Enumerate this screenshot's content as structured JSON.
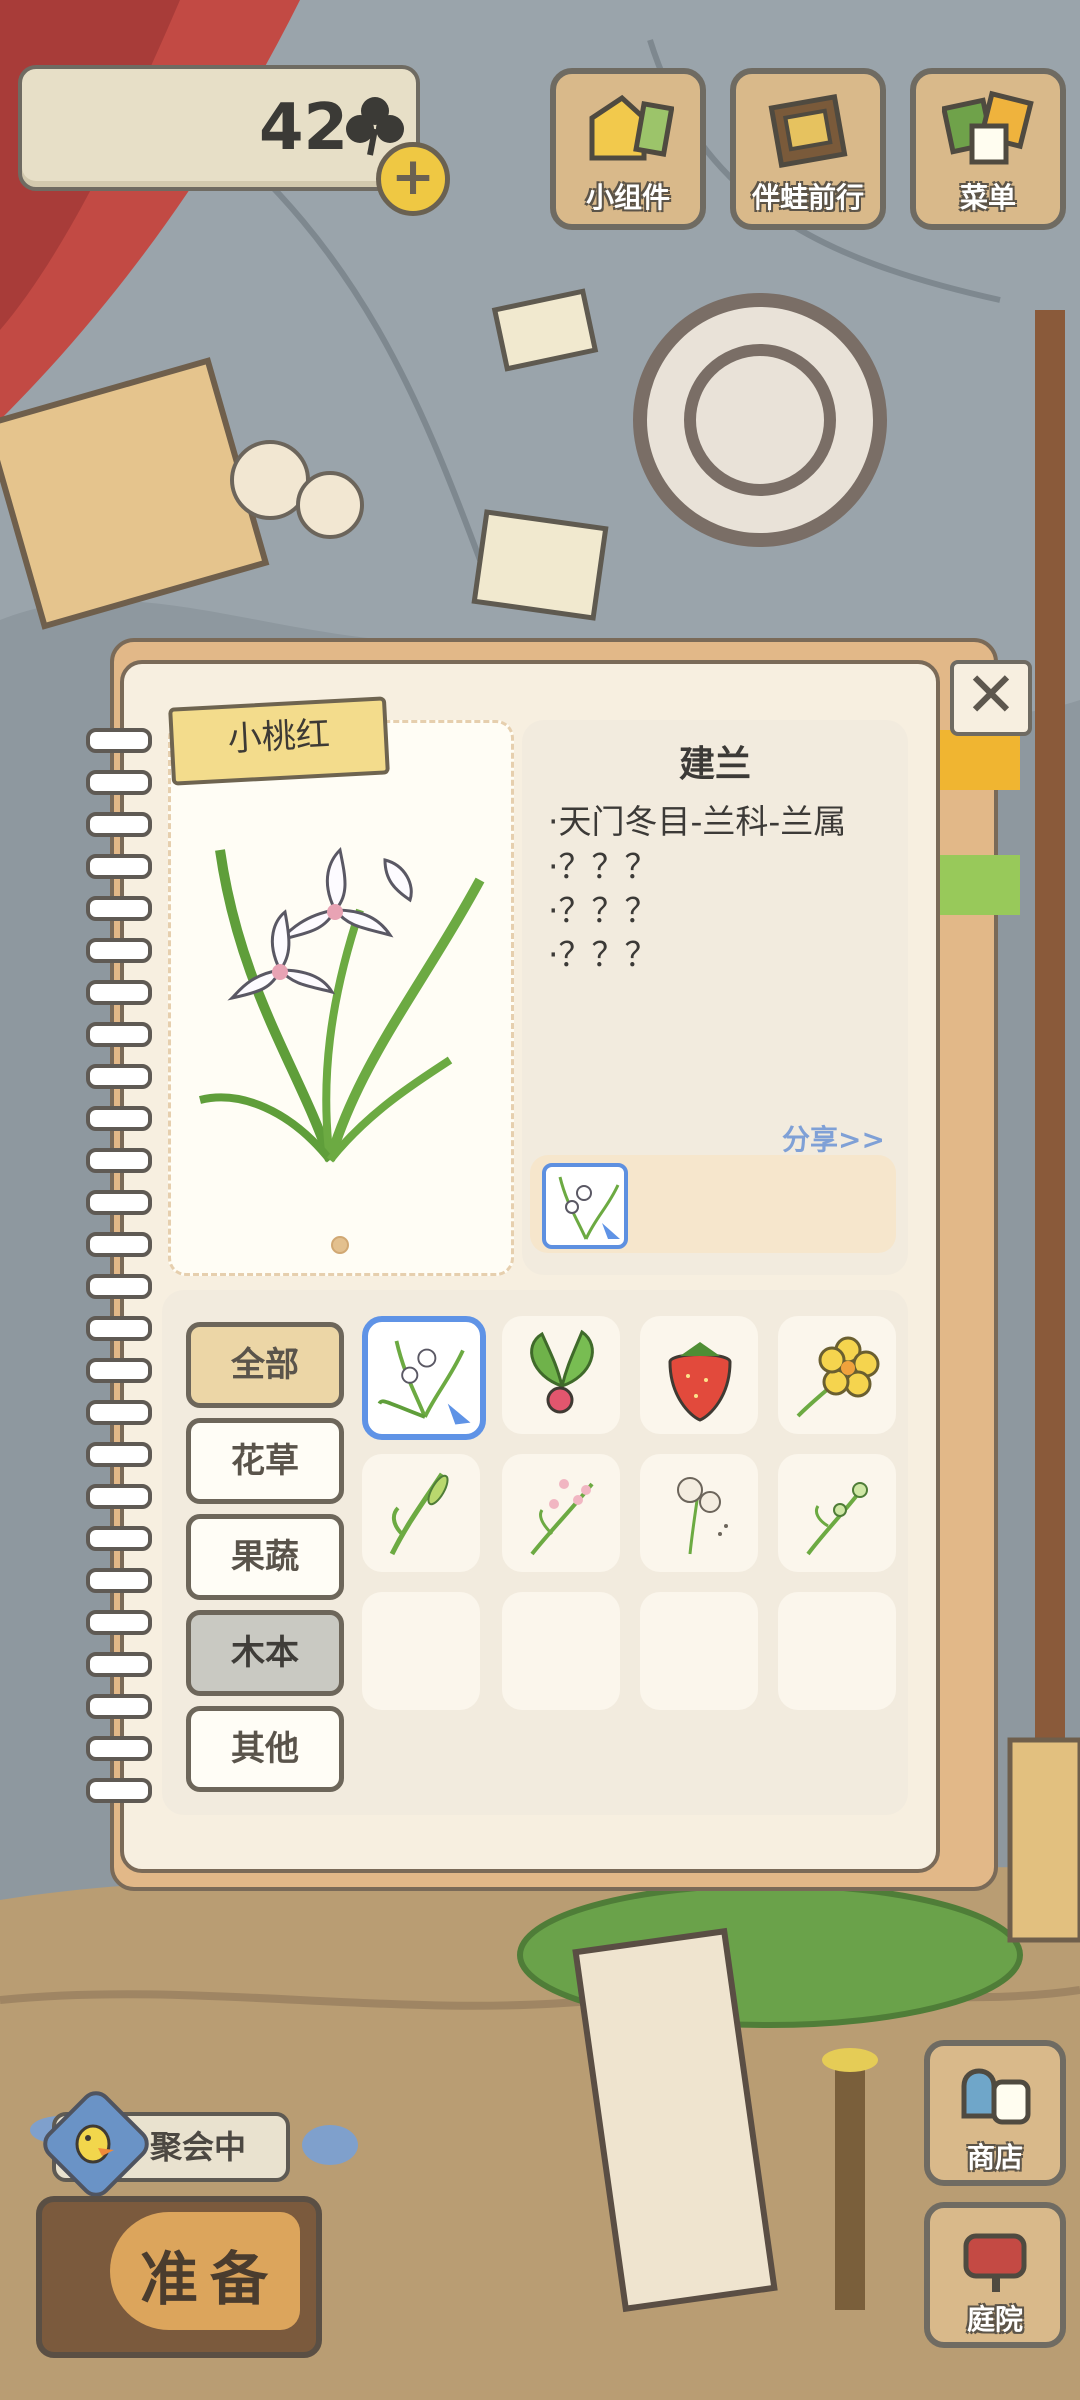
{
  "top_bar": {
    "clover_count": "42",
    "buttons": [
      {
        "label": "小组件",
        "icon": "widget-icon"
      },
      {
        "label": "伴蛙前行",
        "icon": "frog-album-icon"
      },
      {
        "label": "菜单",
        "icon": "menu-icon"
      }
    ]
  },
  "panel": {
    "tag_label": "小桃红",
    "item_title": "建兰",
    "description_lines": [
      "·天门冬目-兰科-兰属",
      "·？？？",
      "·？？？",
      "·？？？"
    ],
    "share_label": "分享>>",
    "categories": [
      {
        "label": "全部",
        "state": "active"
      },
      {
        "label": "花草",
        "state": "normal"
      },
      {
        "label": "果蔬",
        "state": "normal"
      },
      {
        "label": "木本",
        "state": "dim"
      },
      {
        "label": "其他",
        "state": "normal"
      }
    ],
    "grid_items": [
      {
        "icon": "orchid-icon",
        "selected": true
      },
      {
        "icon": "radish-icon",
        "selected": false
      },
      {
        "icon": "strawberry-icon",
        "selected": false
      },
      {
        "icon": "yellow-flower-icon",
        "selected": false
      },
      {
        "icon": "sprout-icon",
        "selected": false
      },
      {
        "icon": "pink-sprig-icon",
        "selected": false
      },
      {
        "icon": "dandelion-icon",
        "selected": false
      },
      {
        "icon": "green-bud-icon",
        "selected": false
      },
      {
        "icon": "",
        "selected": false
      },
      {
        "icon": "",
        "selected": false
      },
      {
        "icon": "",
        "selected": false
      },
      {
        "icon": "",
        "selected": false
      }
    ]
  },
  "bottom": {
    "party_label": "聚会中",
    "prepare_label": "准备",
    "shop_label": "商店",
    "yard_label": "庭院"
  }
}
